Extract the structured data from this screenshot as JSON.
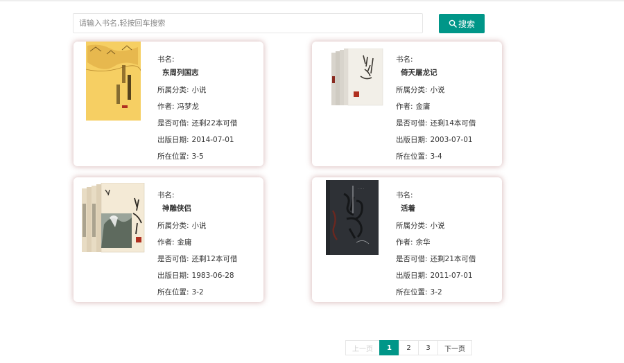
{
  "search": {
    "placeholder": "请输入书名,轻按回车搜索",
    "button_label": "搜索",
    "button_color": "#009688"
  },
  "labels": {
    "name": "书名:",
    "category": "所属分类:",
    "author": "作者:",
    "available": "是否可借:",
    "publish_date": "出版日期:",
    "location": "所在位置:"
  },
  "books": [
    {
      "title": "东周列国志",
      "category": "小说",
      "author": "冯梦龙",
      "available": "还剩22本可借",
      "publish_date": "2014-07-01",
      "location": "3-5"
    },
    {
      "title": "倚天屠龙记",
      "category": "小说",
      "author": "金庸",
      "available": "还剩14本可借",
      "publish_date": "2003-07-01",
      "location": "3-4"
    },
    {
      "title": "神雕侠侣",
      "category": "小说",
      "author": "金庸",
      "available": "还剩12本可借",
      "publish_date": "1983-06-28",
      "location": "3-2"
    },
    {
      "title": "活着",
      "category": "小说",
      "author": "余华",
      "available": "还剩21本可借",
      "publish_date": "2011-07-01",
      "location": "3-2"
    }
  ],
  "pagination": {
    "prev_label": "上一页",
    "next_label": "下一页",
    "pages": [
      "1",
      "2",
      "3"
    ],
    "current": "1"
  }
}
